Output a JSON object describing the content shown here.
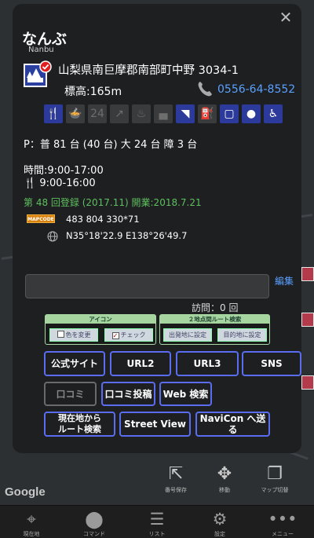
{
  "place": {
    "title": "なんぶ",
    "subtitle": "Nanbu",
    "address": "山梨県南巨摩郡南部町中野 3034-1",
    "altitude": "標高:165m",
    "phone": "0556-64-8552",
    "parking": "P：普 81 台 (40 台) 大 24 台 障 3 台",
    "hours_line1": "時間:9:00-17:00",
    "hours_line2": "9:00-16:00",
    "registration": "第 48 回登録 (2017.11) 開業:2018.7.21",
    "mapcode_label": "MAPCODE",
    "mapcode": "483 804 330*71",
    "coordinates": "N35°18'22.9 E138°26'49.7"
  },
  "facility_icons": [
    {
      "name": "restaurant-icon",
      "on": true,
      "glyph": "🍴"
    },
    {
      "name": "light-meal-icon",
      "on": false,
      "glyph": "🍲"
    },
    {
      "name": "24h-shop-icon",
      "on": false,
      "glyph": "24"
    },
    {
      "name": "shower-icon",
      "on": false,
      "glyph": "↗"
    },
    {
      "name": "hot-spring-icon",
      "on": false,
      "glyph": "♨"
    },
    {
      "name": "bath-icon",
      "on": false,
      "glyph": "▄"
    },
    {
      "name": "wifi-icon",
      "on": true,
      "glyph": "◥"
    },
    {
      "name": "ev-charger-icon",
      "on": false,
      "glyph": "⛽"
    },
    {
      "name": "shopping-icon",
      "on": true,
      "glyph": "▢"
    },
    {
      "name": "park-icon",
      "on": true,
      "glyph": "●"
    },
    {
      "name": "wheelchair-icon",
      "on": true,
      "glyph": "♿"
    }
  ],
  "memo": {
    "value": "",
    "edit_label": "編集",
    "visits": "訪問：0 回"
  },
  "icon_box": {
    "header": "アイコン",
    "change_color": "色を変更",
    "check": "チェック",
    "check_mark": "✓"
  },
  "route_box": {
    "header": "２地点間ルート検索",
    "set_departure": "出発地に設定",
    "set_destination": "目的地に設定"
  },
  "buttons": {
    "official_site": "公式サイト",
    "url2": "URL2",
    "url3": "URL3",
    "sns": "SNS",
    "reviews": "口コミ",
    "post_review": "口コミ投稿",
    "web_search": "Web 検索",
    "route_from_here": "現在地から\nルート検索",
    "street_view": "Street View",
    "send_navicon": "NaviCon へ送る"
  },
  "map": {
    "attribution": "Google",
    "tool_saved": "番号保存",
    "tool_other": "移動",
    "tool_switch": "マップ切替"
  },
  "tabbar": {
    "current": "現在地",
    "command": "コマンド",
    "list": "リスト",
    "settings": "設定",
    "menu": "メニュー"
  },
  "colors": {
    "accent": "#5a6cf0",
    "link": "#5aa0ff",
    "green": "#5fbf5f",
    "icon_on": "#2c3a9c"
  }
}
